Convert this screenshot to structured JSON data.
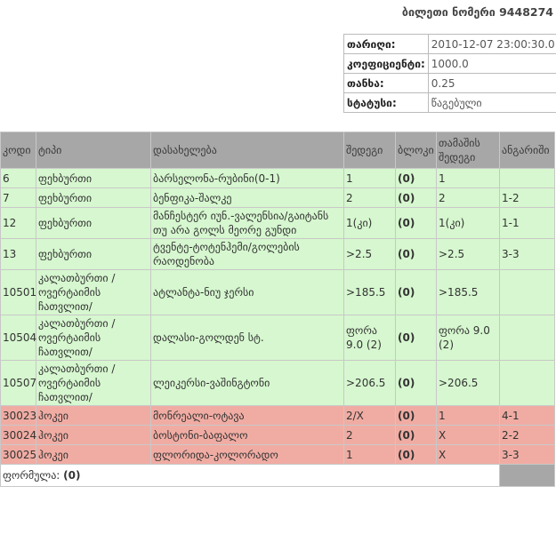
{
  "ticket_title": "ბილეთი ნომერი 9448274",
  "info": [
    {
      "label": "თარიღი:",
      "value": "2010-12-07 23:00:30.0"
    },
    {
      "label": "კოეფიციენტი:",
      "value": "1000.0"
    },
    {
      "label": "თანხა:",
      "value": "0.25"
    },
    {
      "label": "სტატუსი:",
      "value": "წაგებული"
    }
  ],
  "columns": [
    "კოდი",
    "ტიპი",
    "დასახელება",
    "შედეგი",
    "ბლოკი",
    "თამაშის შედეგი",
    "ანგარიში"
  ],
  "rows": [
    {
      "status": "green",
      "code": "6",
      "type": "ფეხბურთი",
      "name": "ბარსელონა-რუბინი(0-1)",
      "result": "1",
      "block": "(0)",
      "game_result": "1",
      "score": ""
    },
    {
      "status": "green",
      "code": "7",
      "type": "ფეხბურთი",
      "name": "ბენფიკა-შალკე",
      "result": "2",
      "block": "(0)",
      "game_result": "2",
      "score": "1-2"
    },
    {
      "status": "green",
      "code": "12",
      "type": "ფეხბურთი",
      "name": "მანჩესტერ იუნ.-ვალენსია/გაიტანს თუ არა გოლს მეორე გუნდი",
      "result": "1(კი)",
      "block": "(0)",
      "game_result": "1(კი)",
      "score": "1-1"
    },
    {
      "status": "green",
      "code": "13",
      "type": "ფეხბურთი",
      "name": "ტვენტე-ტოტენჰემი/გოლების რაოდენობა",
      "result": ">2.5",
      "block": "(0)",
      "game_result": ">2.5",
      "score": "3-3"
    },
    {
      "status": "green",
      "code": "10501",
      "type": "კალათბურთი /ოვერტაიმის ჩათვლით/",
      "name": "ატლანტა-ნიუ ჯერსი",
      "result": ">185.5",
      "block": "(0)",
      "game_result": ">185.5",
      "score": ""
    },
    {
      "status": "green",
      "code": "10504",
      "type": "კალათბურთი /ოვერტაიმის ჩათვლით/",
      "name": "დალასი-გოლდენ სტ.",
      "result": "ფორა 9.0 (2)",
      "block": "(0)",
      "game_result": "ფორა 9.0 (2)",
      "score": ""
    },
    {
      "status": "green",
      "code": "10507",
      "type": "კალათბურთი /ოვერტაიმის ჩათვლით/",
      "name": "ლეიკერსი-ვაშინგტონი",
      "result": ">206.5",
      "block": "(0)",
      "game_result": ">206.5",
      "score": ""
    },
    {
      "status": "red",
      "code": "30023",
      "type": "ჰოკეი",
      "name": "მონრეალი-ოტავა",
      "result": "2/X",
      "block": "(0)",
      "game_result": "1",
      "score": "4-1"
    },
    {
      "status": "red",
      "code": "30024",
      "type": "ჰოკეი",
      "name": "ბოსტონი-ბაფალო",
      "result": "2",
      "block": "(0)",
      "game_result": "X",
      "score": "2-2"
    },
    {
      "status": "red",
      "code": "30025",
      "type": "ჰოკეი",
      "name": "ფლორიდა-კოლორადო",
      "result": "1",
      "block": "(0)",
      "game_result": "X",
      "score": "3-3"
    }
  ],
  "formula": {
    "label": "ფორმულა:",
    "value": "(0)"
  },
  "colors": {
    "header": "#a7a7a7",
    "won_row": "#d6f7cf",
    "lost_row": "#f0aca3"
  }
}
